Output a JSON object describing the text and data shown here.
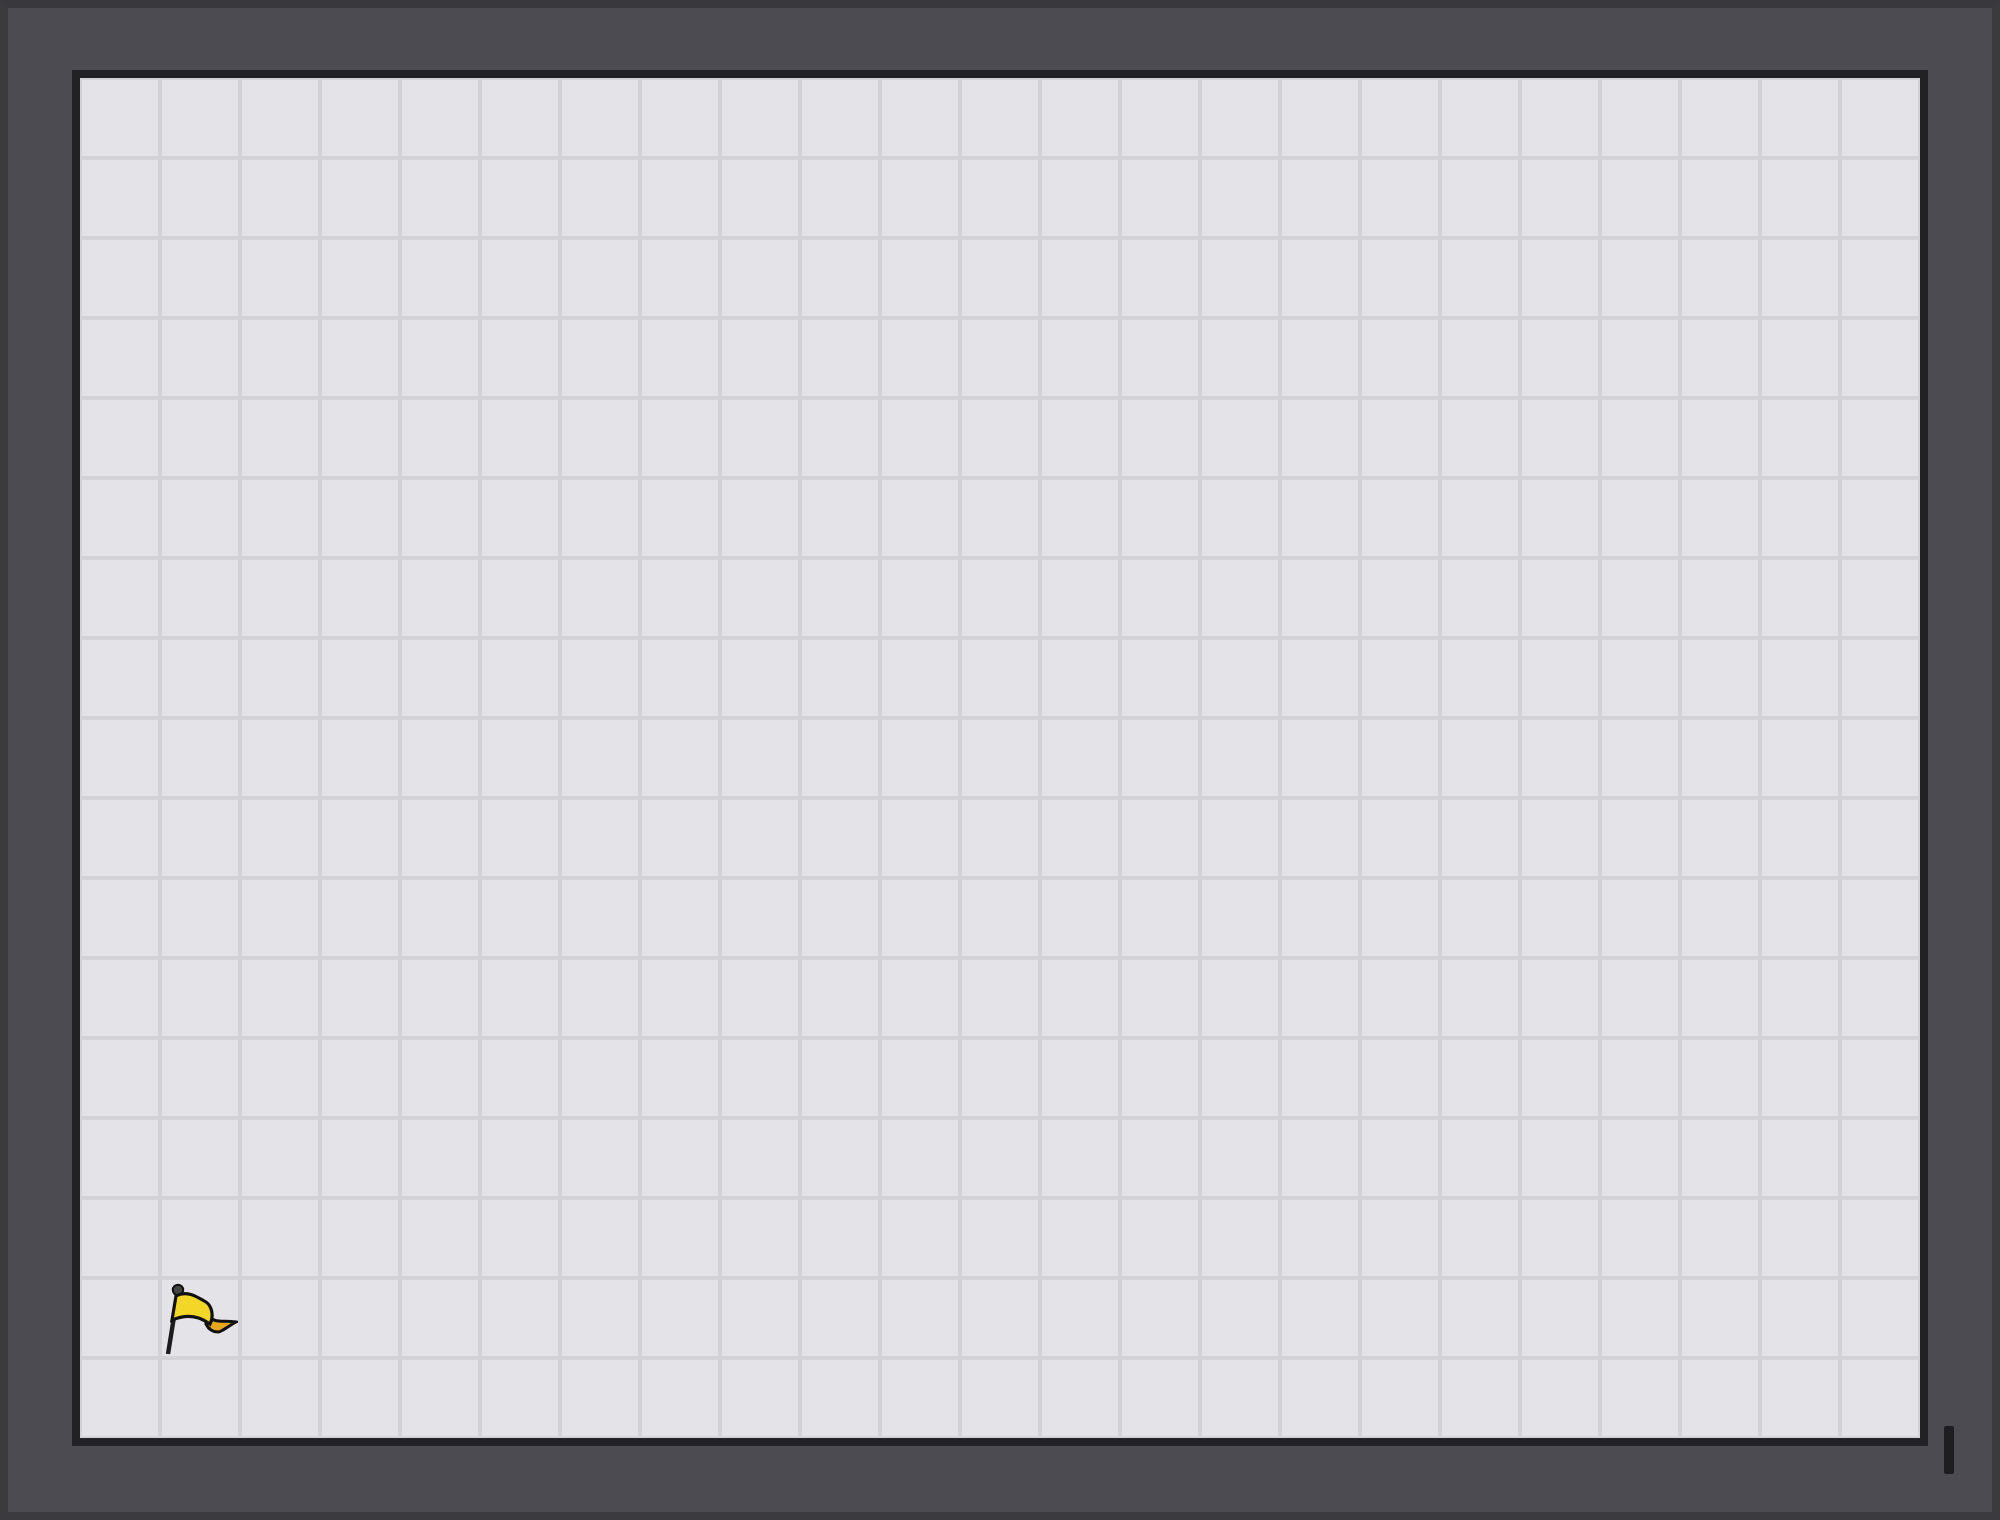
{
  "board": {
    "markers": [
      {
        "kind": "flag"
      }
    ]
  }
}
